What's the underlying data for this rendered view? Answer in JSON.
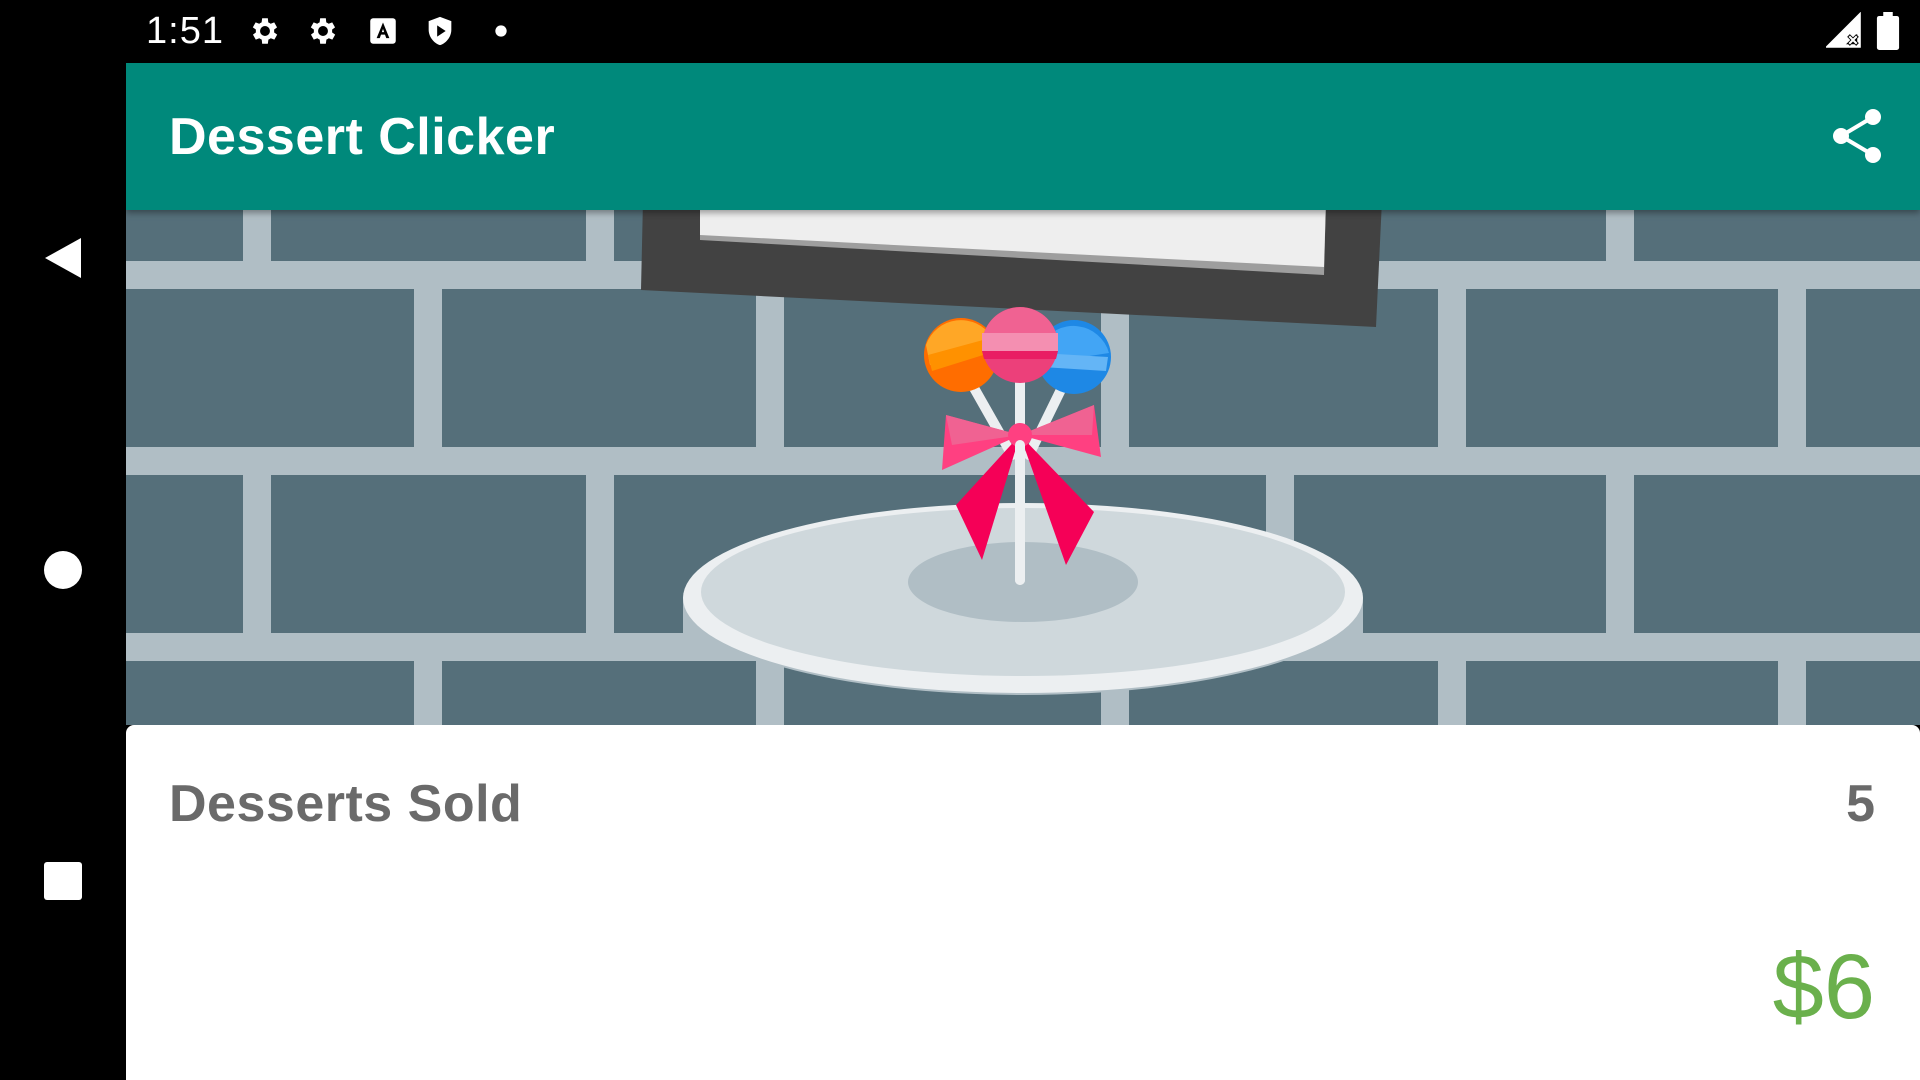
{
  "status_bar": {
    "time": "1:51",
    "icons": [
      "gear-icon",
      "gear-icon",
      "a-badge-icon",
      "shield-play-icon",
      "dot-icon"
    ],
    "right_icons": [
      "signal-no-data-icon",
      "battery-icon"
    ]
  },
  "nav": {
    "items": [
      "back",
      "home",
      "recents"
    ]
  },
  "app_bar": {
    "title": "Dessert Clicker",
    "action_icon": "share-icon",
    "color": "#00897b"
  },
  "scene": {
    "dessert": "lollipop-icon"
  },
  "card": {
    "desserts_sold_label": "Desserts Sold",
    "desserts_sold_count": "5",
    "revenue": "$6",
    "revenue_color": "#6ab04c"
  }
}
